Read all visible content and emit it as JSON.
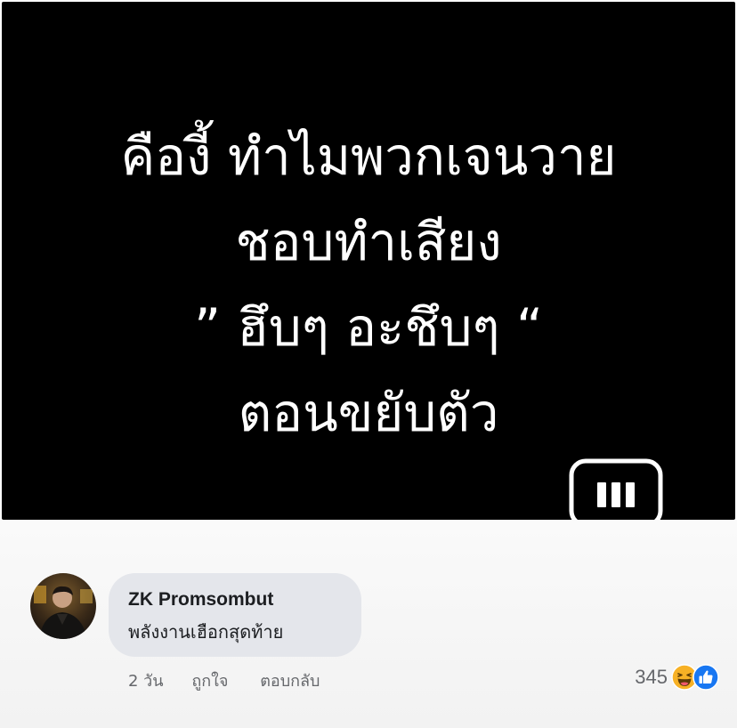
{
  "post": {
    "lines": [
      "คืองี้ ทำไมพวกเจนวาย",
      "ชอบทำเสียง",
      "” ฮึบๆ อะชึบๆ “",
      "ตอนขยับตัว"
    ],
    "background_color": "#000000",
    "text_color": "#ffffff",
    "logo_icon": "speech-bubble-bars-logo-icon"
  },
  "comment": {
    "author": "ZK Promsombut",
    "text": "พลังงานเฮือกสุดท้าย",
    "time": "2 วัน",
    "like_label": "ถูกใจ",
    "reply_label": "ตอบกลับ",
    "reaction_count": "345",
    "reaction_icons": [
      "haha-reaction-icon",
      "like-reaction-icon"
    ],
    "bubble_color": "#e4e6eb",
    "like_color": "#1877f2",
    "haha_color": "#f7b125"
  }
}
